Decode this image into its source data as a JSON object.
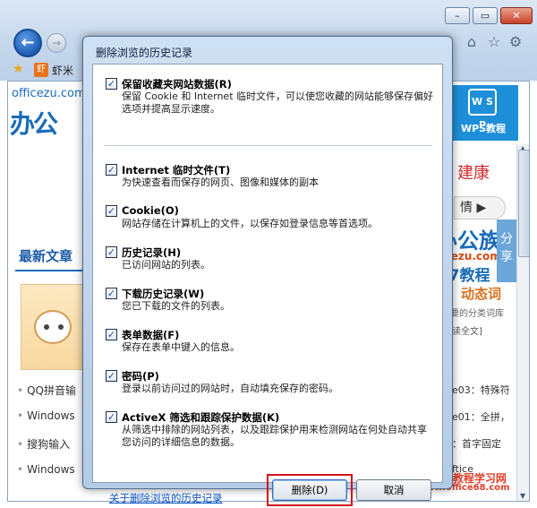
{
  "browser": {
    "window_buttons": {
      "minimize": "–",
      "maximize": "▭",
      "close": "✕"
    },
    "nav": {
      "back": "←",
      "forward": "→"
    },
    "toolbar_icons": {
      "home": "⌂",
      "favorites": "☆",
      "tools": "⚙"
    },
    "favorites_bar": {
      "site_icon": "虾",
      "site_label": "虾米"
    }
  },
  "page": {
    "logo_url": "officezu.com",
    "logo_big": "办公",
    "wps": {
      "logo": "W S P",
      "label": "WPS教程"
    },
    "health_text": "建康",
    "detail_pill": "情 ▶",
    "share_tab": "分享",
    "side_brand": {
      "line1": "办公族",
      "line2": "Officezu.com",
      "line3": "Win7教程"
    },
    "dynamic_text": "动态词",
    "side_line1": "要的分类词库",
    "side_line2": "读全文]",
    "latest_title": "最新文章",
    "list_rows": [
      "QQ拼音输",
      "Windows",
      "搜狗输入",
      "Windows"
    ],
    "right_rows": [
      "e03：特殊符",
      "e01：全拼，",
      "：首字固定",
      "ftice"
    ],
    "watermark": {
      "top": "Office教程学习网",
      "bottom": "www.office68.com"
    }
  },
  "dialog": {
    "title": "删除浏览的历史记录",
    "check_mark": "✓",
    "options": [
      {
        "title": "保留收藏夹网站数据(R)",
        "desc": "保留 Cookie 和 Internet 临时文件，可以使您收藏的网站能够保存偏好选项并提高显示速度。",
        "checked": true
      },
      {
        "title": "Internet 临时文件(T)",
        "desc": "为快速查看而保存的网页、图像和媒体的副本",
        "checked": true
      },
      {
        "title": "Cookie(O)",
        "desc": "网站存储在计算机上的文件，以保存如登录信息等首选项。",
        "checked": true
      },
      {
        "title": "历史记录(H)",
        "desc": "已访问网站的列表。",
        "checked": true
      },
      {
        "title": "下载历史记录(W)",
        "desc": "您已下载的文件的列表。",
        "checked": true
      },
      {
        "title": "表单数据(F)",
        "desc": "保存在表单中键入的信息。",
        "checked": true
      },
      {
        "title": "密码(P)",
        "desc": "登录以前访问过的网站时，自动填充保存的密码。",
        "checked": true
      },
      {
        "title": "ActiveX 筛选和跟踪保护数据(K)",
        "desc": "从筛选中排除的网站列表，以及跟踪保护用来检测网站在何处自动共享您访问的详细信息的数据。",
        "checked": true
      }
    ],
    "about_link": "关于删除浏览的历史记录",
    "delete_button": "删除(D)",
    "cancel_button": "取消"
  }
}
